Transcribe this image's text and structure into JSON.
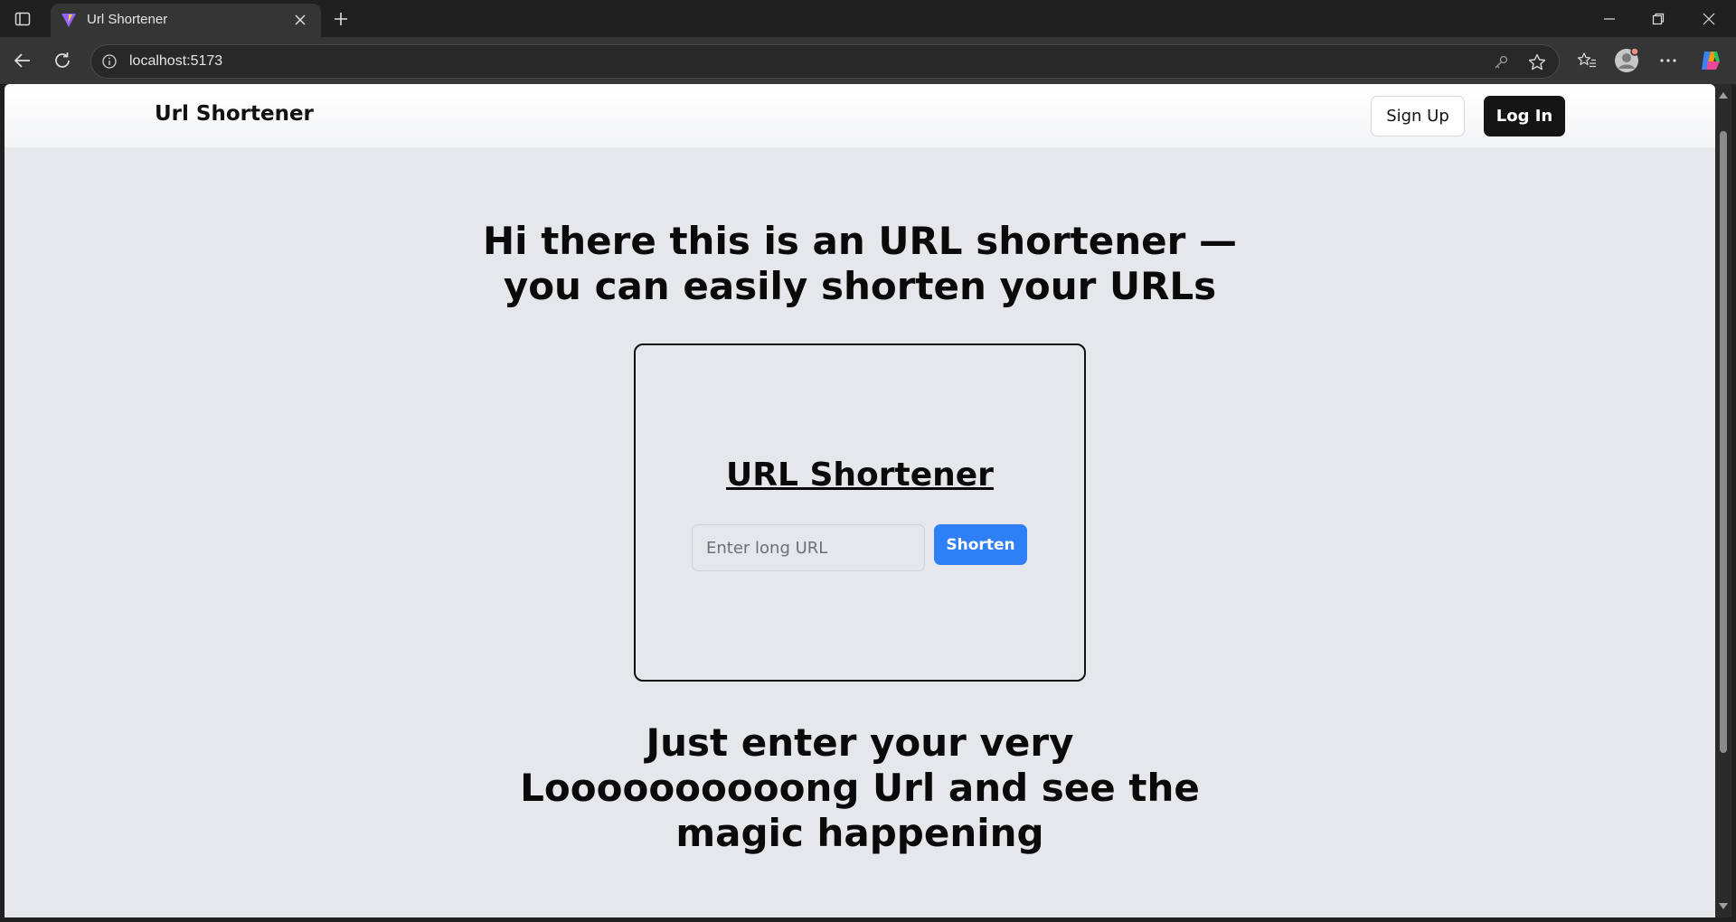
{
  "browser": {
    "tab": {
      "title": "Url Shortener"
    },
    "address_bar": {
      "url": "localhost:5173"
    }
  },
  "header": {
    "brand": "Url Shortener",
    "signup_label": "Sign Up",
    "login_label": "Log In"
  },
  "hero": {
    "line1": "Hi there this is an URL shortener —",
    "line2": "you can easily shorten your URLs"
  },
  "card": {
    "title": "URL Shortener",
    "input": {
      "value": "",
      "placeholder": "Enter long URL"
    },
    "button_label": "Shorten"
  },
  "tagline": {
    "line1": "Just enter your very",
    "line2": "Loooooooooong Url and see the",
    "line3": "magic happening"
  },
  "colors": {
    "page_background": "#e5e7eb",
    "primary_button": "#2f80f7",
    "login_button": "#151515"
  }
}
